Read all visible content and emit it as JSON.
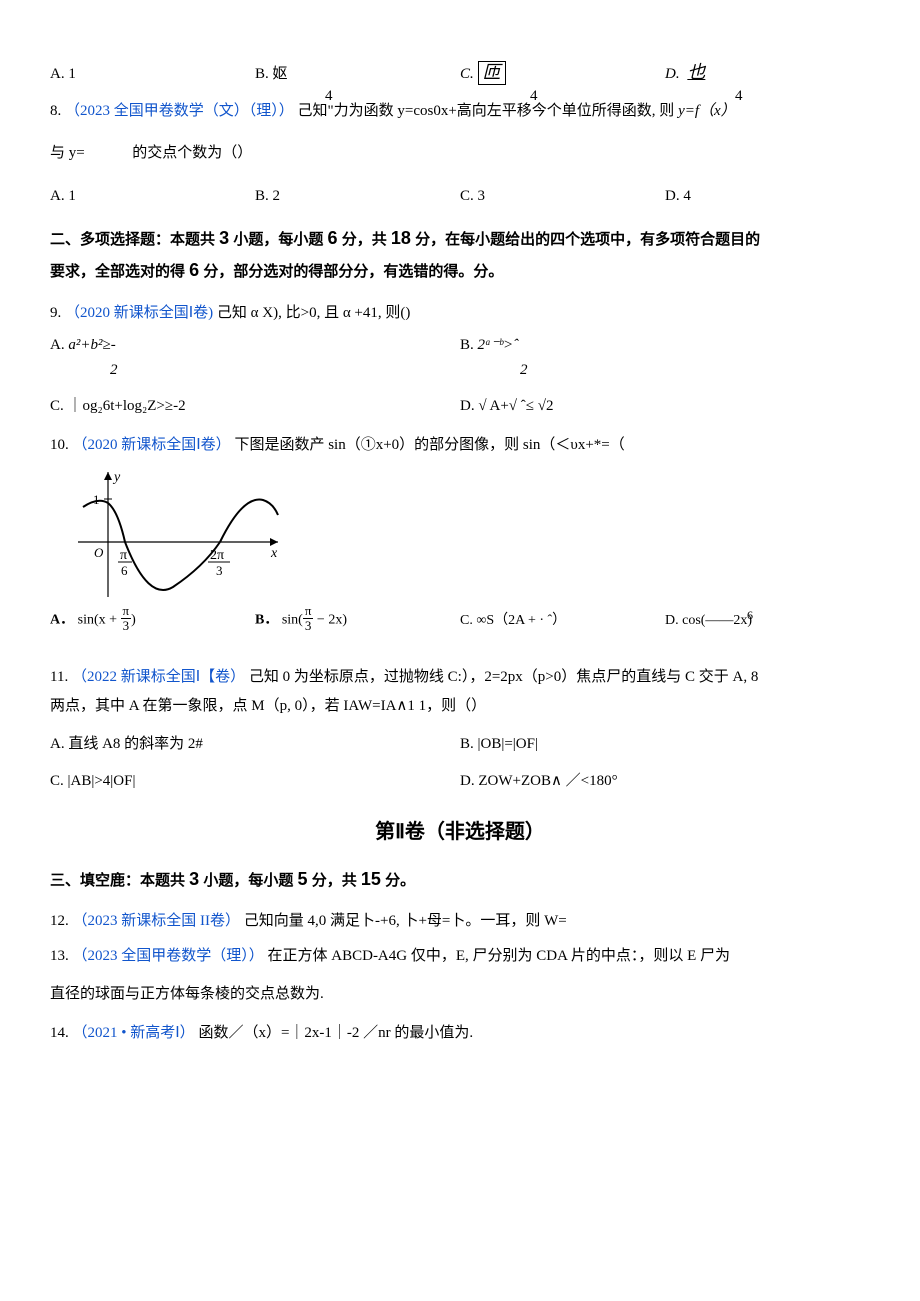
{
  "q7": {
    "A": "A. 1",
    "B": "B. 妪",
    "B_den": "4",
    "C_pref": "C. ",
    "C": "匝",
    "C_den": "4",
    "D_pref": "D. ",
    "D": "也",
    "D_den": "4"
  },
  "q8": {
    "source": "（2023 全国甲卷数学（文）（理））",
    "stem1": "8. ",
    "text1": "己知\"力为函数 y=cos0x+高向左平移今个单位所得函数, 则 ",
    "yexpr": "y=f（x）",
    "text2": "与 y=",
    "text3": "的交点个数为（）",
    "A": "A. 1",
    "B": "B. 2",
    "C": "C. 3",
    "D": "D. 4"
  },
  "section2": {
    "line1_a": "二、多项选择题：本题共 ",
    "n1": "3",
    "line1_b": " 小题，每小题 ",
    "n2": "6",
    "line1_c": " 分，共 ",
    "n3": "18",
    "line1_d": " 分，在每小题给出的四个选项中，有多项符合题目的",
    "line2_a": "要求，全部选对的得 ",
    "n4": "6",
    "line2_b": " 分，部分选对的得部分分，有选错的得。分。"
  },
  "q9": {
    "num": "9. ",
    "source": "（2020 新课标全国Ⅰ卷)",
    "text": "己知 α X), 比>0, 且 α +41, 则()",
    "A": "A.",
    "A_body": " a²+b²≥-",
    "A_den": "2",
    "B": "B.",
    "B_body": " 2ᵃ⁻ᵇ>ˆ",
    "B_den": "2",
    "C": "C. ｜og₂6t+log₂Z>≥-2",
    "D": "D. √ A+√ ˆ≤ √2"
  },
  "q10": {
    "num": "10.   ",
    "source": "（2020 新课标全国Ⅰ卷）",
    "text": "下图是函数产 sin（①x+0）的部分图像，则 sin（＜υx+*=（",
    "A_pref": "A．",
    "A_body": "sin(x + ",
    "A_frac_num": "π",
    "A_frac_den": "3",
    "A_tail": ")",
    "B_pref": "B．",
    "B_body": "sin(",
    "B_frac_num": "π",
    "B_frac_den": "3",
    "B_tail": " − 2x)",
    "C": "C.   ∞S（2A + · ˆ）",
    "D": "D.   cos(——2x)",
    "D_frac": "6"
  },
  "q11": {
    "num": "11.   ",
    "source": "（2022 新课标全国Ⅰ【卷）",
    "text1": "己知 0 为坐标原点，过抛物线 C:），2=2px（p>0）焦点尸的直线与 C 交于 A, 8",
    "text2": "两点，其中 A 在第一象限，点 M（p, 0），若 IAW=IA∧1 1，则（）",
    "A": "A. 直线 A8 的斜率为 2#",
    "B": "B. |OB|=|OF|",
    "C": "C. |AB|>4|OF|",
    "D": "D. ZOW+ZOB∧ ／<180°"
  },
  "partII": "第Ⅱ卷（非选择题）",
  "section3": {
    "a": "三、填空鹿：本题共 ",
    "n1": "3",
    "b": " 小题，每小题 ",
    "n2": "5",
    "c": " 分，共 ",
    "n3": "15",
    "d": " 分。"
  },
  "q12": {
    "num": "12. ",
    "source": "（2023 新课标全国 II卷）",
    "text": "己知向量 4,0 满足卜-+6, 卜+母=卜。一耳，则 W="
  },
  "q13": {
    "num": "13. ",
    "source": "（2023 全国甲卷数学（理））",
    "text1": "在正方体 ABCD-A4G 仅中，E, 尸分别为 CDA 片的中点：，则以 E 尸为",
    "text2": "直径的球面与正方体每条棱的交点总数为."
  },
  "q14": {
    "num": "14. ",
    "source": "（2021 • 新高考Ⅰ）",
    "text": "函数／（x）=｜2x-1｜-2 ／nr 的最小值为."
  },
  "chart_data": {
    "type": "line",
    "title": "",
    "xlabel": "x",
    "ylabel": "y",
    "description": "Partial graph of y = sin(ωx + φ)",
    "x_ticks": [
      {
        "label": "π/6",
        "value": 0.5236
      },
      {
        "label": "2π/3",
        "value": 2.0944
      }
    ],
    "y_ticks": [
      {
        "label": "1",
        "value": 1
      }
    ],
    "ylim": [
      -1.2,
      1.2
    ],
    "xlim": [
      -0.6,
      3.1
    ],
    "curve_zero_crossings": [
      0.5236,
      2.0944
    ],
    "curve_min_x": 1.309,
    "curve_min_y": -1,
    "curve_max_y_near_origin": 0.866
  }
}
